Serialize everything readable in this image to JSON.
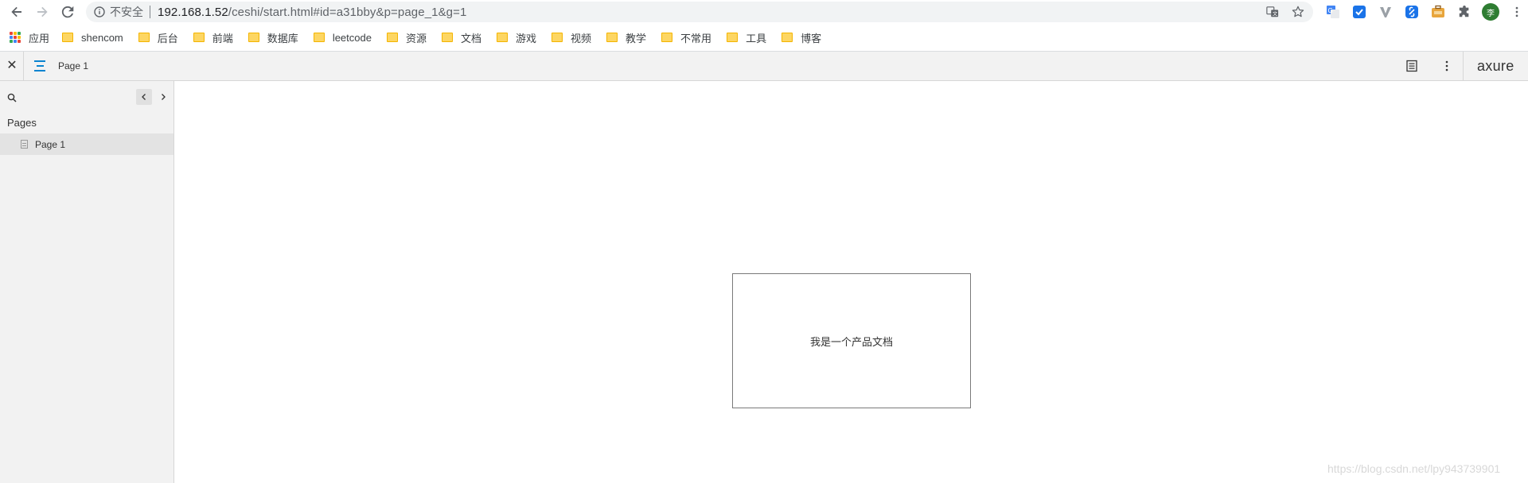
{
  "browser": {
    "security_label": "不安全",
    "url_host": "192.168.1.52",
    "url_path": "/ceshi/start.html#id=a31bby&p=page_1&g=1",
    "profile_initial": "李"
  },
  "bookmarks": {
    "apps_label": "应用",
    "items": [
      "shencom",
      "后台",
      "前端",
      "数据库",
      "leetcode",
      "资源",
      "文档",
      "游戏",
      "视频",
      "教学",
      "不常用",
      "工具",
      "博客"
    ]
  },
  "axure": {
    "page_title": "Page 1",
    "logo": "axure"
  },
  "sidebar": {
    "heading": "Pages",
    "pages": [
      "Page 1"
    ]
  },
  "canvas": {
    "box_text": "我是一个产品文档"
  },
  "watermark": "https://blog.csdn.net/lpy943739901",
  "colors": {
    "avatar": "#2e7d32",
    "folder": "#fdd663",
    "accent_blue": "#1a73e8"
  }
}
